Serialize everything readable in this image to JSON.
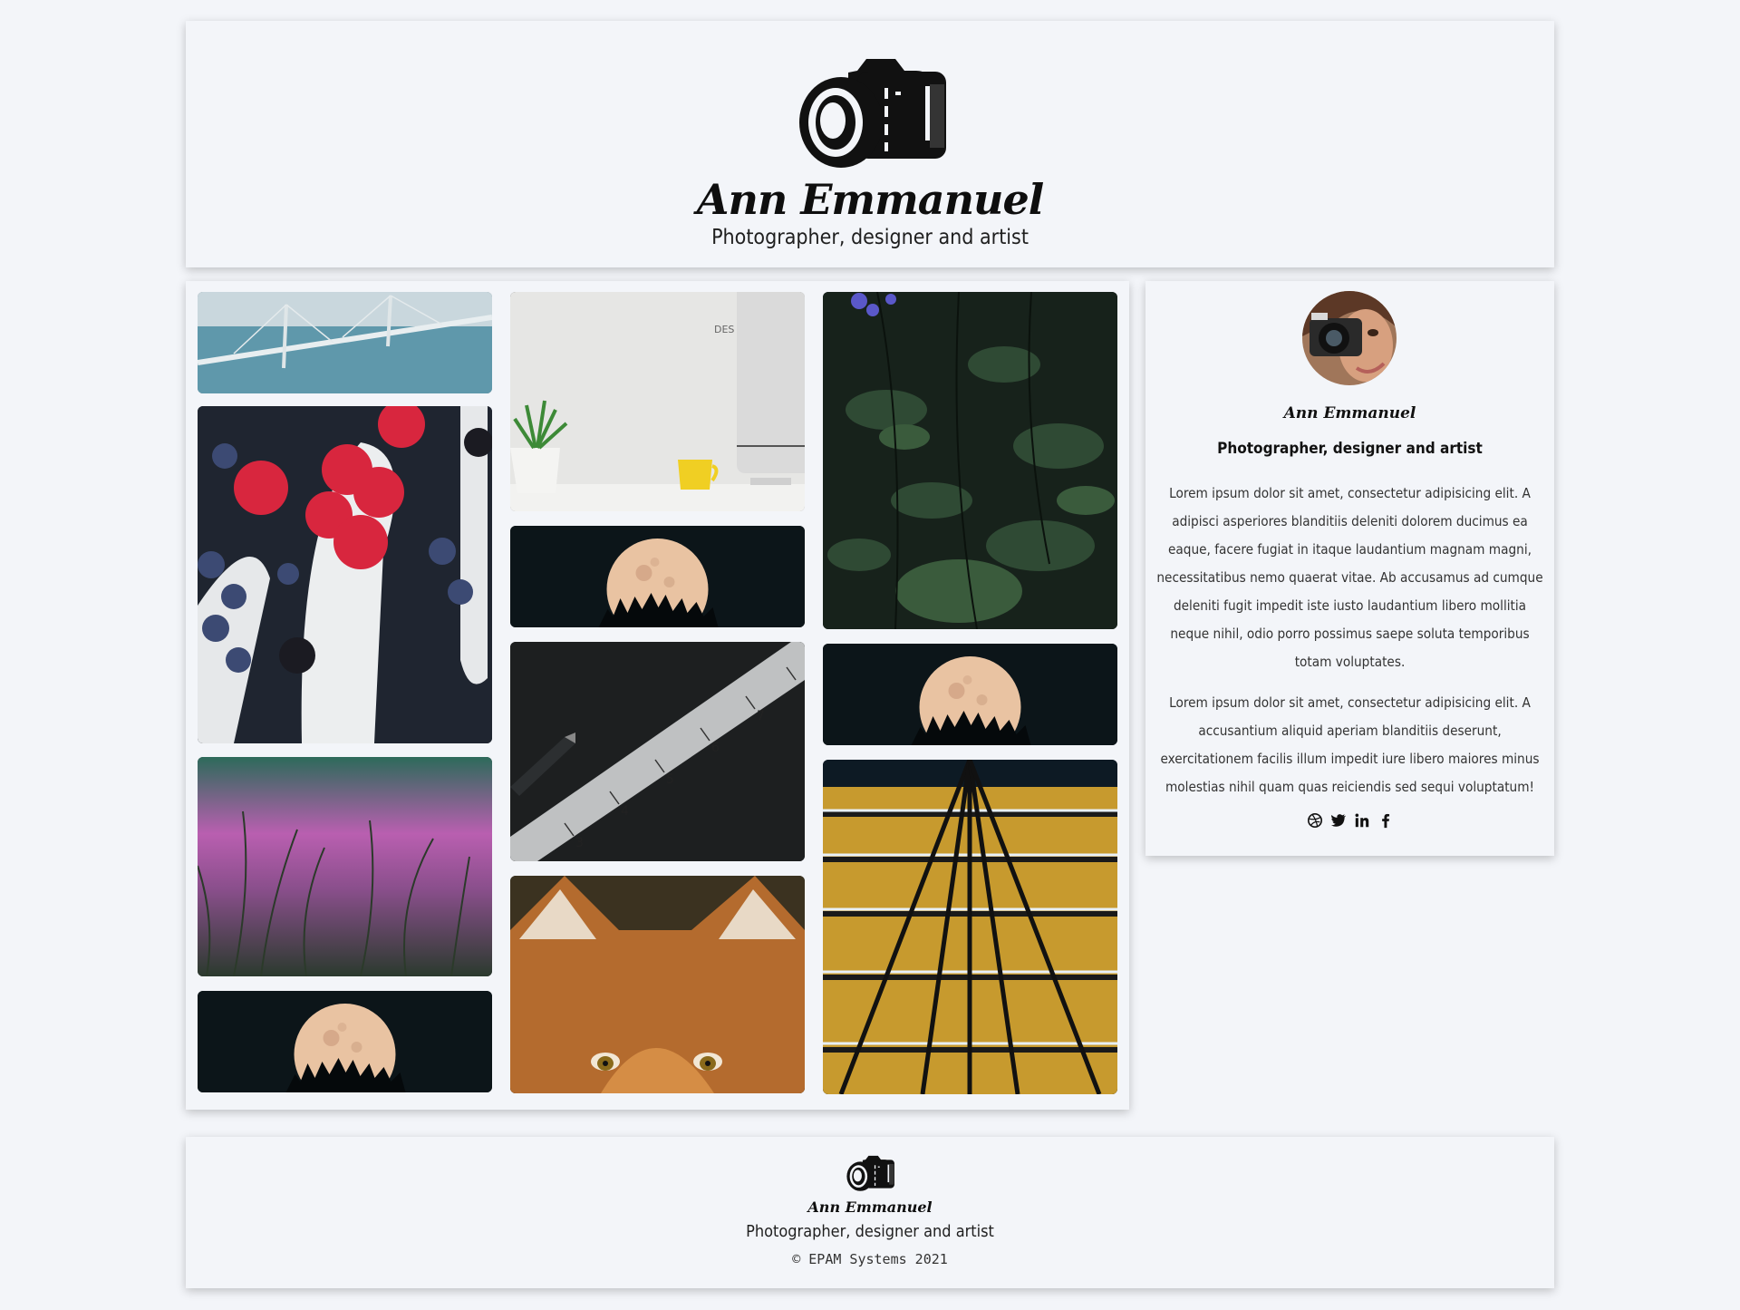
{
  "header": {
    "logo_icon": "camera-logo-icon",
    "name": "Ann Emmanuel",
    "tagline": "Photographer, designer and artist"
  },
  "gallery": {
    "photos": [
      {
        "subject": "cable-stayed bridge over water"
      },
      {
        "subject": "raspberries and blueberries in white spoons"
      },
      {
        "subject": "pink blurred grass"
      },
      {
        "subject": "full moon over trees"
      },
      {
        "subject": "desk with plant, yellow mug and monitor"
      },
      {
        "subject": "full moon over trees"
      },
      {
        "subject": "metal ruler and pen on black surface"
      },
      {
        "subject": "close-up of fox face"
      },
      {
        "subject": "forest plants with purple flowers"
      },
      {
        "subject": "full moon over trees"
      },
      {
        "subject": "lit building facade from below"
      }
    ]
  },
  "about": {
    "name": "Ann Emmanuel",
    "role": "Photographer, designer and artist",
    "paragraph1": "Lorem ipsum dolor sit amet, consectetur adipisicing elit. A adipisci asperiores blanditiis deleniti dolorem ducimus ea eaque, facere fugiat in itaque laudantium magnam magni, necessitatibus nemo quaerat vitae. Ab accusamus ad cumque deleniti fugit impedit iste iusto laudantium libero mollitia neque nihil, odio porro possimus saepe soluta temporibus totam voluptates.",
    "paragraph2": "Lorem ipsum dolor sit amet, consectetur adipisicing elit. A accusantium aliquid aperiam blanditiis deserunt, exercitationem facilis illum impedit iure libero maiores minus molestias nihil quam quas reiciendis sed sequi voluptatum!",
    "socials": [
      "dribbble-icon",
      "twitter-icon",
      "linkedin-icon",
      "facebook-icon"
    ]
  },
  "footer": {
    "logo_icon": "camera-logo-icon",
    "name": "Ann Emmanuel",
    "tagline": "Photographer, designer and artist",
    "copyright": "© EPAM Systems 2021"
  }
}
